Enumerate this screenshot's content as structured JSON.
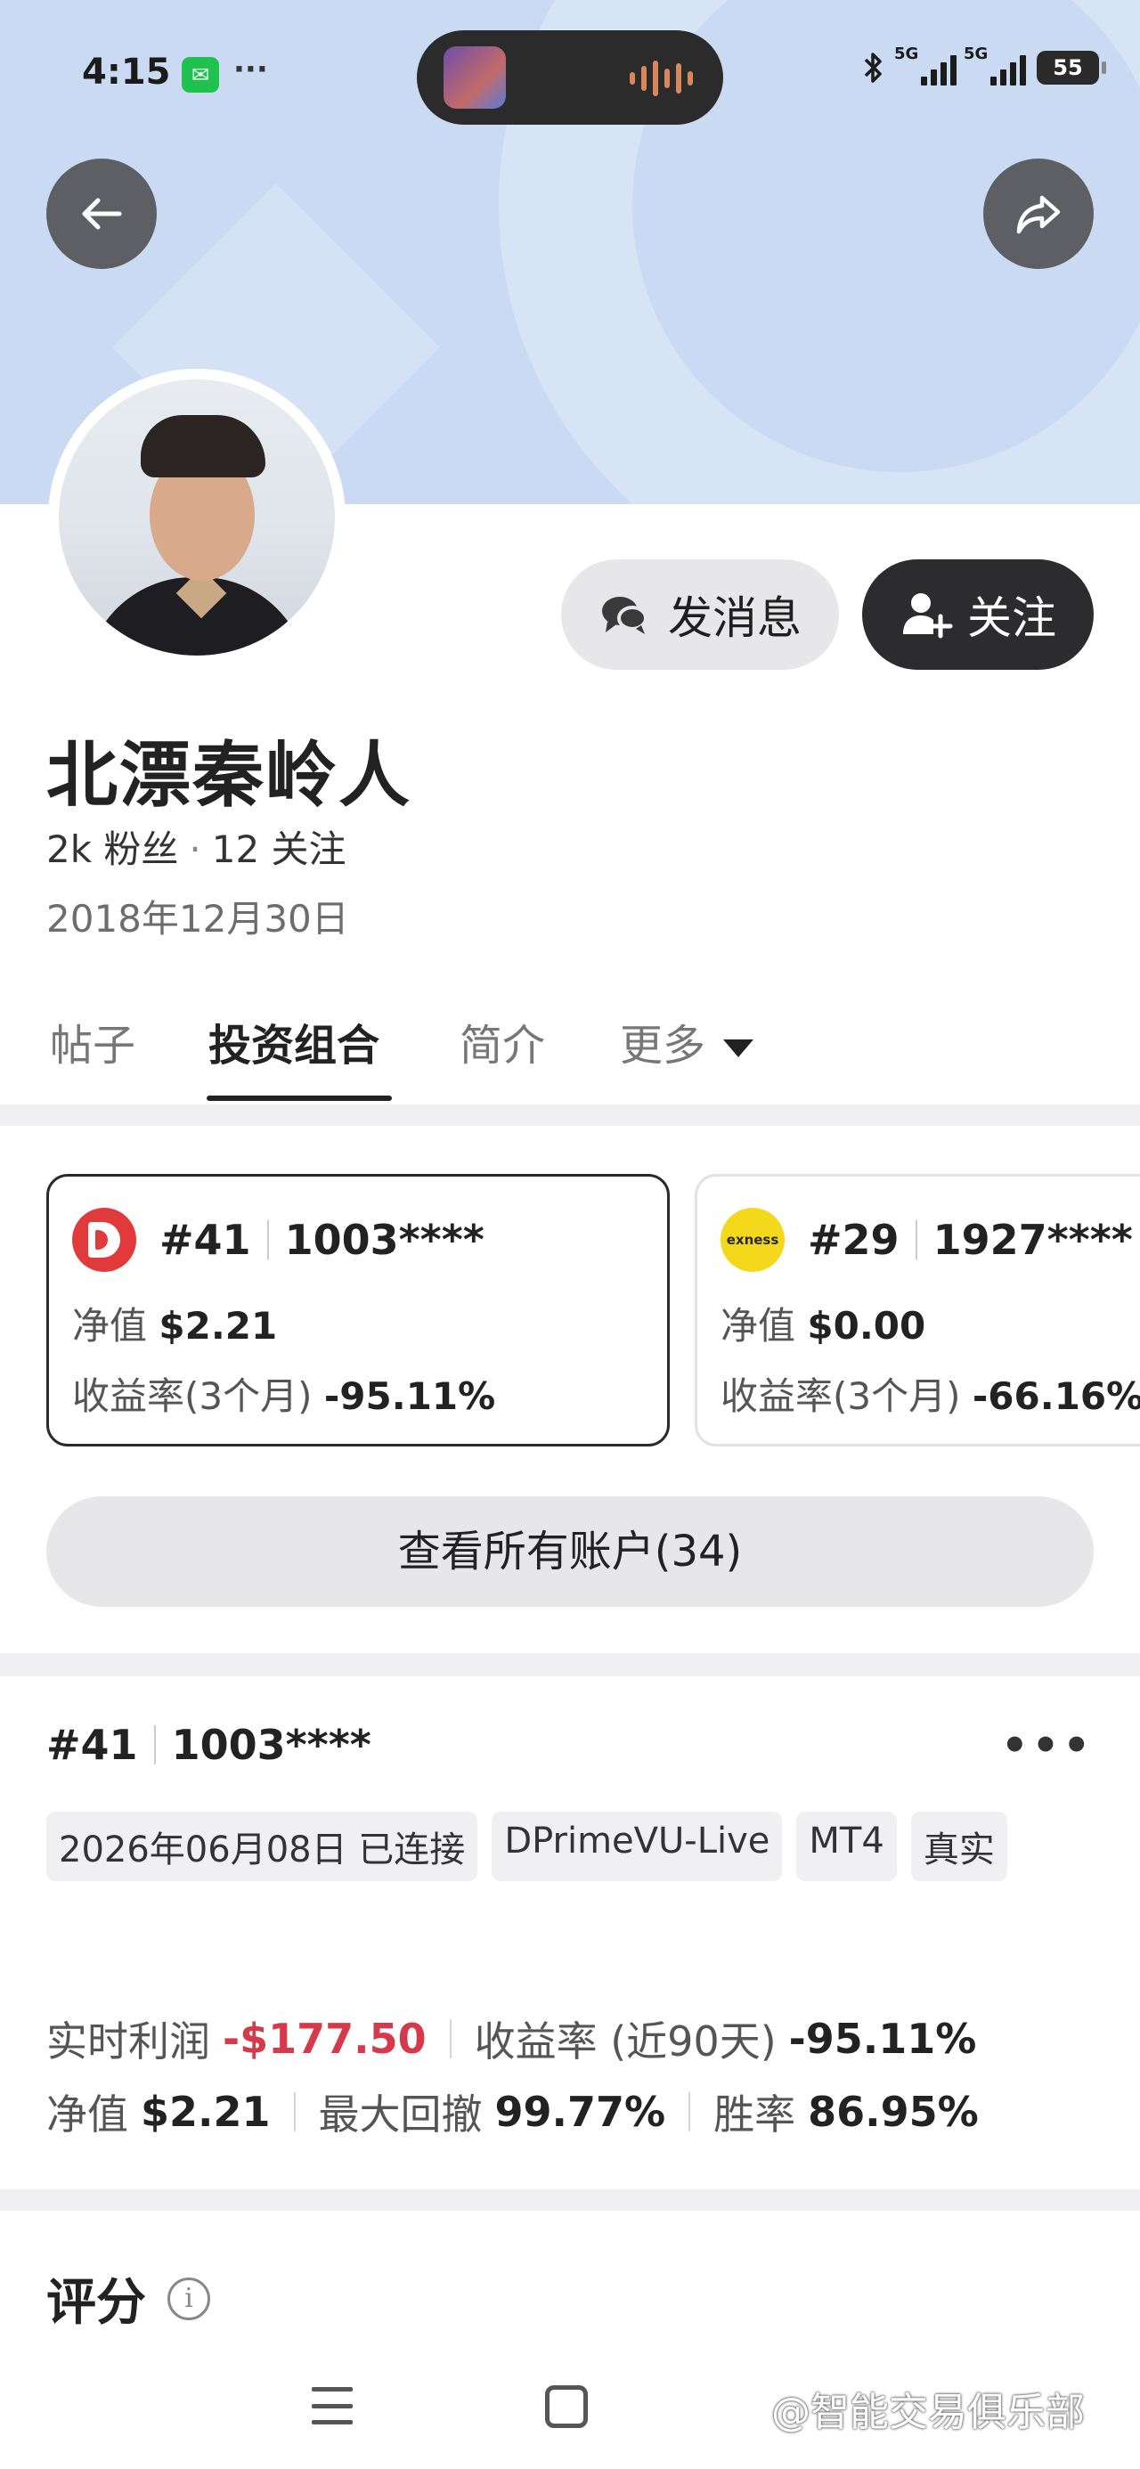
{
  "status_bar": {
    "time": "4:15",
    "more": "···",
    "net1": "5G",
    "net2": "5G",
    "battery": "55"
  },
  "profile": {
    "name": "北漂秦岭人",
    "followers": "2k 粉丝",
    "separator": "·",
    "following": "12 关注",
    "joined": "2018年12月30日",
    "message_btn": "发消息",
    "follow_btn": "关注"
  },
  "tabs": [
    {
      "label": "帖子"
    },
    {
      "label": "投资组合"
    },
    {
      "label": "简介"
    },
    {
      "label": "更多"
    }
  ],
  "accounts": [
    {
      "rank": "#41",
      "number": "1003****",
      "equity_label": "净值",
      "equity": "$2.21",
      "return_label": "收益率(3个月)",
      "return": "-95.11%",
      "broker_color": "#e23a3a"
    },
    {
      "rank": "#29",
      "number": "1927****",
      "equity_label": "净值",
      "equity": "$0.00",
      "return_label": "收益率(3个月)",
      "return": "-66.16%",
      "broker_logo_text": "exness",
      "broker_color": "#f4d81c"
    }
  ],
  "all_accounts_btn": "查看所有账户(34)",
  "detail": {
    "rank": "#41",
    "number": "1003****",
    "tags": [
      "2026年06月08日 已连接",
      "DPrimeVU-Live",
      "MT4",
      "真实"
    ],
    "realtime_profit_label": "实时利润",
    "realtime_profit": "-$177.50",
    "return_label": "收益率 (近90天)",
    "return": "-95.11%",
    "equity_label": "净值",
    "equity": "$2.21",
    "drawdown_label": "最大回撤",
    "drawdown": "99.77%",
    "winrate_label": "胜率",
    "winrate": "86.95%"
  },
  "rating": {
    "title": "评分",
    "info": "i"
  },
  "watermark": "@智能交易俱乐部",
  "colors": {
    "banner": "#c9daf2",
    "loss_red": "#d63a4a",
    "dark_button": "#2c2c2e"
  }
}
